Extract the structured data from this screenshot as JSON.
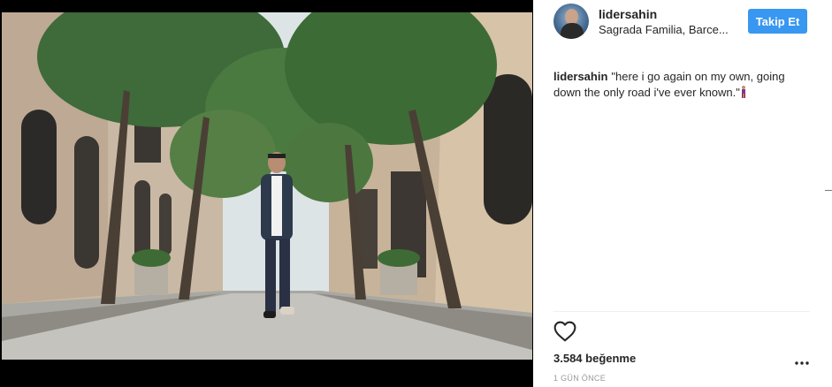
{
  "post": {
    "username": "lidersahin",
    "location": "Sagrada Familia, Barce...",
    "follow_label": "Takip Et",
    "caption_user": "lidersahin",
    "caption_text": "\"here i go again on my own, going down the only road i've ever known.\"",
    "caption_emoji": "person-walking-emoji",
    "likes": "3.584 beğenme",
    "timestamp": "1 GÜN ÖNCE"
  },
  "icons": {
    "like": "heart-outline-icon",
    "more": "more-options-icon"
  },
  "colors": {
    "follow_button": "#3897f0",
    "photo_frame": "#000000",
    "text": "#262626",
    "muted": "#999999"
  }
}
